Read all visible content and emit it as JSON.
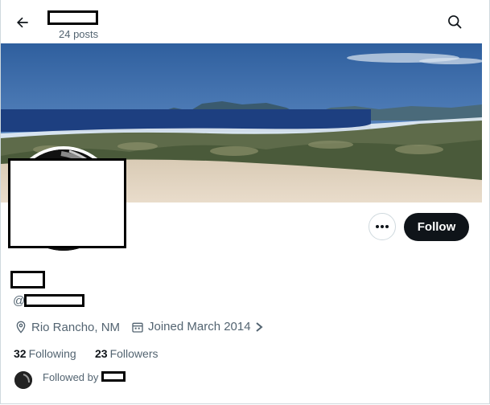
{
  "header": {
    "posts_count": "24 posts"
  },
  "profile": {
    "handle_prefix": "@",
    "location": "Rio Rancho, NM",
    "joined": "Joined March 2014",
    "following_count": "32",
    "following_label": "Following",
    "followers_count": "23",
    "followers_label": "Followers",
    "followed_by_label": "Followed by"
  },
  "actions": {
    "follow_label": "Follow"
  },
  "icons": {
    "back": "arrow-left-icon",
    "search": "search-icon",
    "more": "more-icon",
    "location": "location-pin-icon",
    "calendar": "calendar-icon",
    "chevron": "chevron-right-icon"
  },
  "colors": {
    "text_primary": "#0f1419",
    "text_secondary": "#536471",
    "button_dark": "#0f1419",
    "border": "#cfd9de"
  }
}
